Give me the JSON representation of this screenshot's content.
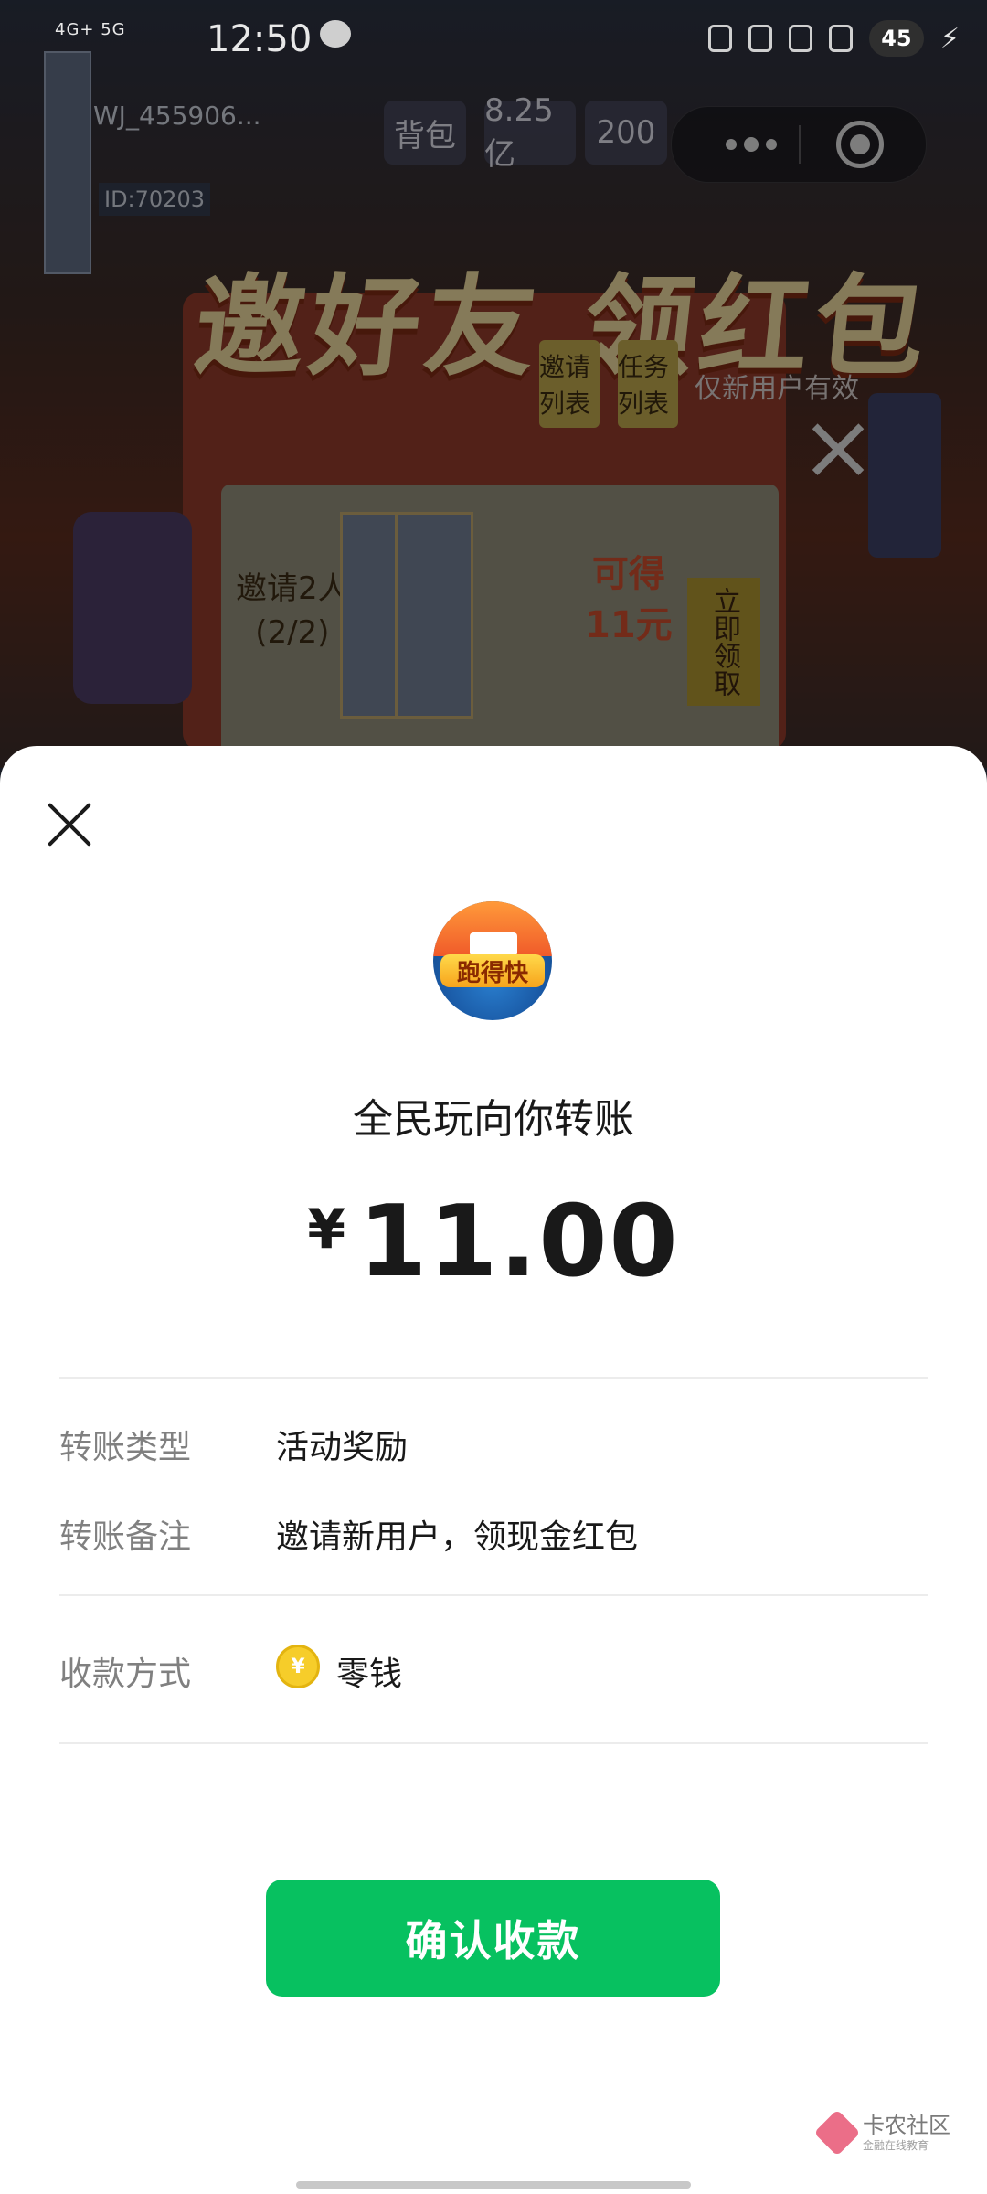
{
  "status_bar": {
    "signal": "4G+ 5G",
    "time": "12:50",
    "battery": "45"
  },
  "background_game": {
    "player_name": "WJ_455906...",
    "player_id": "ID:70203",
    "resource_1": "背包",
    "resource_2": "8.25亿",
    "resource_3": "200",
    "banner_title": "邀好友 领红包",
    "chip_invite_list": "邀请列表",
    "chip_task_list": "任务列表",
    "new_user_only": "仅新用户有效",
    "invite_progress": "邀请2人\n(2/2)",
    "reward": "可得\n11元",
    "claim_button": "立即领取"
  },
  "sheet": {
    "app_logo_text": "跑得快",
    "title": "全民玩向你转账",
    "currency_symbol": "¥",
    "amount": "11.00",
    "rows": [
      {
        "label": "转账类型",
        "value": "活动奖励"
      },
      {
        "label": "转账备注",
        "value": "邀请新用户，领现金红包"
      },
      {
        "label": "收款方式",
        "value": "零钱"
      }
    ],
    "coin_symbol": "¥",
    "confirm_button": "确认收款"
  },
  "watermark": {
    "name": "卡农社区",
    "sub": "金融在线教育"
  },
  "colors": {
    "confirm_green": "#07c160",
    "coin_yellow": "#f6cd2a"
  }
}
